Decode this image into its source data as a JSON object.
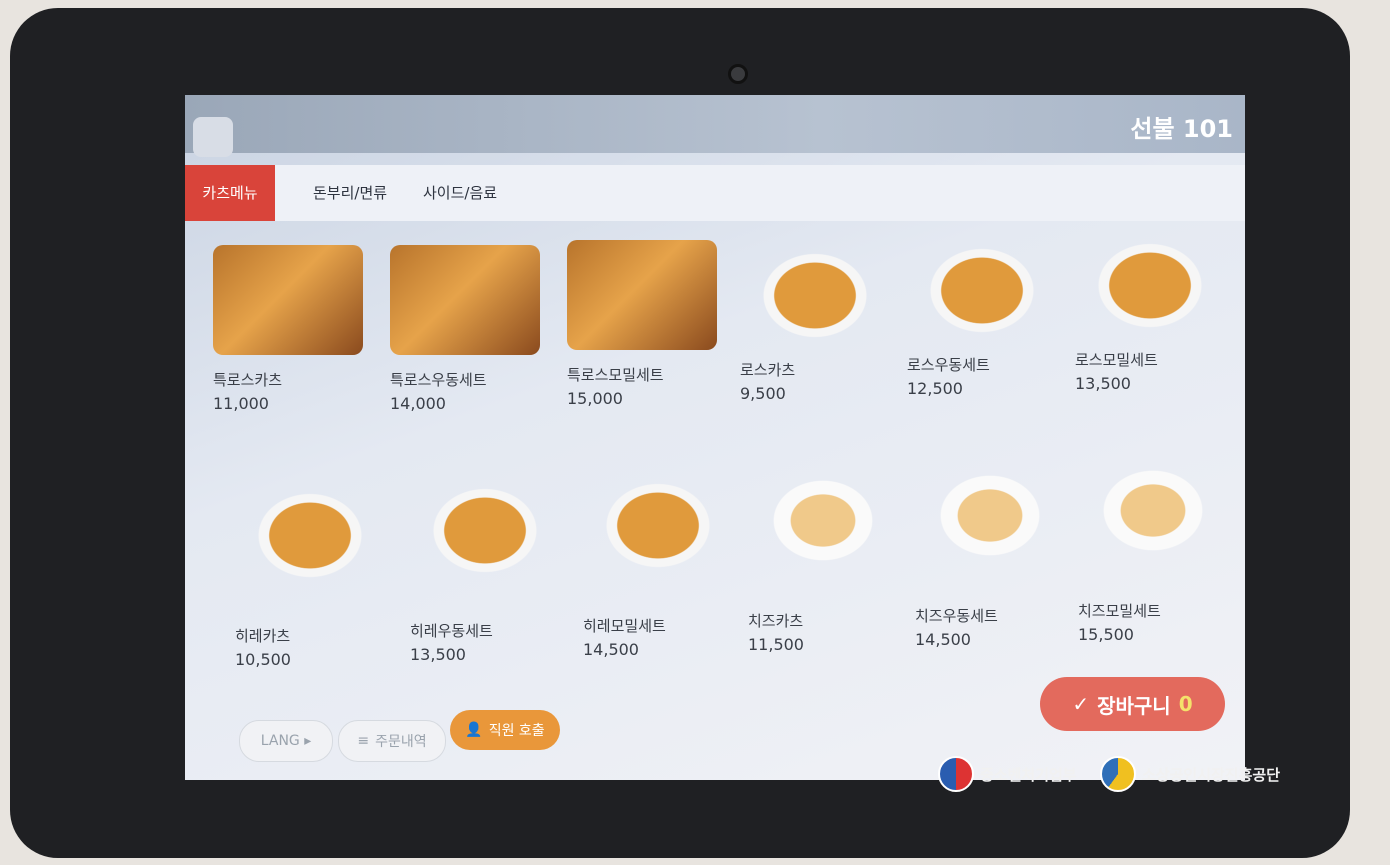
{
  "header": {
    "table_label": "선불 101"
  },
  "tabs": [
    "카츠메뉴",
    "돈부리/면류",
    "사이드/음료"
  ],
  "menu": [
    {
      "name": "특로스카츠",
      "price": "11,000"
    },
    {
      "name": "특로스우동세트",
      "price": "14,000"
    },
    {
      "name": "특로스모밀세트",
      "price": "15,000"
    },
    {
      "name": "로스카츠",
      "price": "9,500"
    },
    {
      "name": "로스우동세트",
      "price": "12,500"
    },
    {
      "name": "로스모밀세트",
      "price": "13,500"
    },
    {
      "name": "히레카츠",
      "price": "10,500"
    },
    {
      "name": "히레우동세트",
      "price": "13,500"
    },
    {
      "name": "히레모밀세트",
      "price": "14,500"
    },
    {
      "name": "치즈카츠",
      "price": "11,500"
    },
    {
      "name": "치즈우동세트",
      "price": "14,500"
    },
    {
      "name": "치즈모밀세트",
      "price": "15,500"
    }
  ],
  "bottom": {
    "lang_label": "LANG ▸",
    "history_label": "주문내역",
    "staff_label": "직원 호출"
  },
  "cart": {
    "label": "장바구니",
    "count": "0"
  },
  "sponsors": [
    "중소벤처기업부",
    "소상공인시장진흥공단"
  ]
}
